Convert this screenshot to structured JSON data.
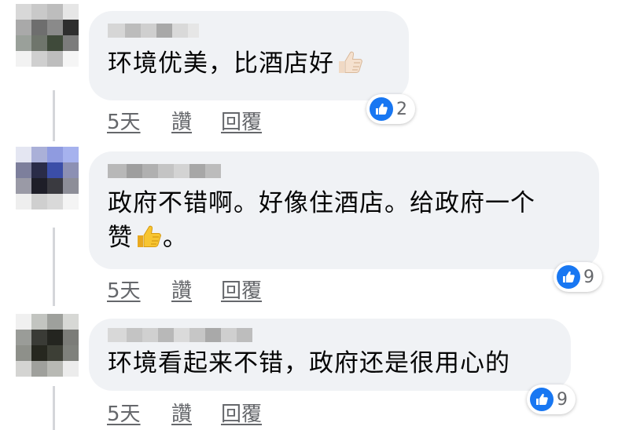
{
  "comments": [
    {
      "text": "环境优美，比酒店好",
      "emoji": "thumbs-up-light",
      "actions": {
        "time": "5天",
        "like": "讚",
        "reply": "回覆"
      },
      "reactions": {
        "icon": "like-icon",
        "count": "2"
      }
    },
    {
      "text_line1": "政府不错啊。好像住酒店。给政府一个",
      "text_line2_pre": "赞",
      "emoji": "thumbs-up-yellow",
      "text_line2_post": "。",
      "actions": {
        "time": "5天",
        "like": "讚",
        "reply": "回覆"
      },
      "reactions": {
        "icon": "like-icon",
        "count": "9"
      }
    },
    {
      "text": "环境看起来不错，政府还是很用心的",
      "actions": {
        "time": "5天",
        "like": "讚",
        "reply": "回覆"
      },
      "reactions": {
        "icon": "like-icon",
        "count": "9"
      }
    }
  ],
  "colors": {
    "bubble": "#f0f2f5",
    "like_blue": "#1877f2",
    "meta_gray": "#65676b"
  }
}
